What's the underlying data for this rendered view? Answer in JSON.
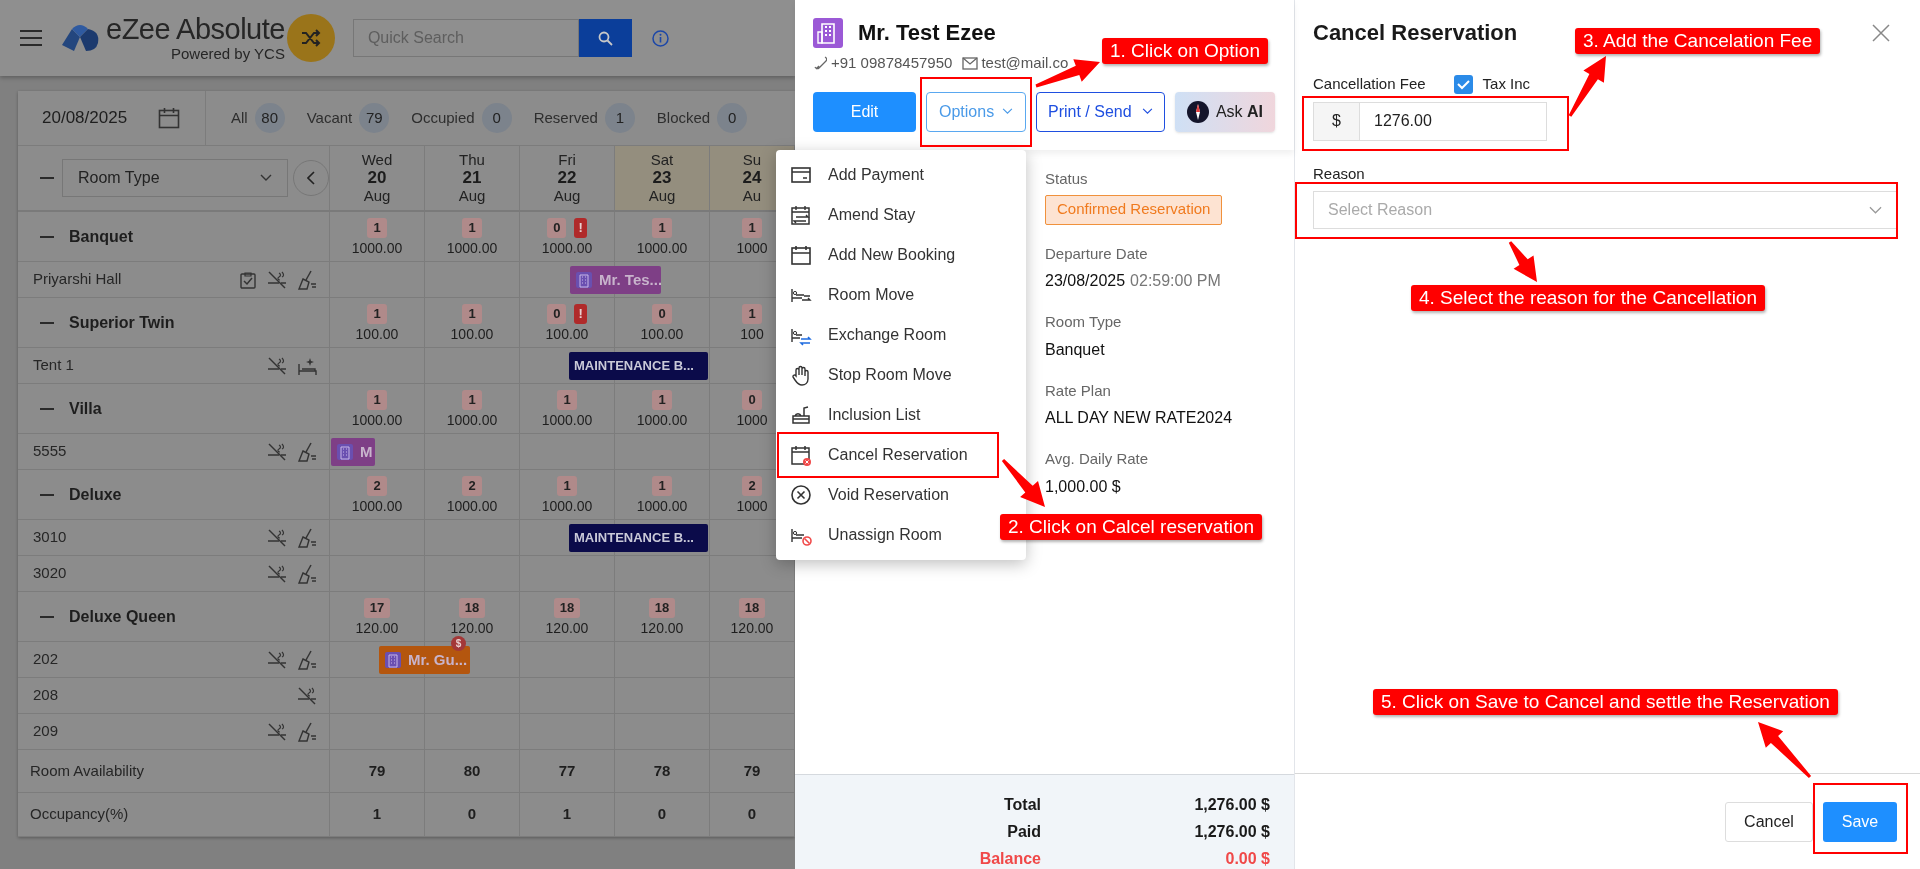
{
  "app": {
    "logo_title": "eZee Absolute",
    "logo_subtitle": "Powered by YCS",
    "search": {
      "placeholder": "Quick Search"
    }
  },
  "calendar": {
    "date": "20/08/2025",
    "filters": [
      {
        "label": "All",
        "count": "80"
      },
      {
        "label": "Vacant",
        "count": "79"
      },
      {
        "label": "Occupied",
        "count": "0"
      },
      {
        "label": "Reserved",
        "count": "1"
      },
      {
        "label": "Blocked",
        "count": "0"
      }
    ],
    "room_type_select": "Room Type",
    "days": [
      {
        "weekday": "Wed",
        "date": "20",
        "month": "Aug",
        "weekend": false
      },
      {
        "weekday": "Thu",
        "date": "21",
        "month": "Aug",
        "weekend": false
      },
      {
        "weekday": "Fri",
        "date": "22",
        "month": "Aug",
        "weekend": false
      },
      {
        "weekday": "Sat",
        "date": "23",
        "month": "Aug",
        "weekend": true
      },
      {
        "weekday": "Su",
        "date": "24",
        "month": "Au",
        "weekend": true
      }
    ],
    "groups": [
      {
        "name": "Banquet",
        "cells": [
          {
            "available": "1",
            "rate": "1000.00"
          },
          {
            "available": "1",
            "rate": "1000.00"
          },
          {
            "available": "0",
            "alert": "!",
            "rate": "1000.00"
          },
          {
            "available": "1",
            "rate": "1000.00"
          },
          {
            "available": "1",
            "rate": "1000"
          }
        ],
        "rooms": [
          {
            "name": "Priyarshi Hall",
            "bookings": [
              {
                "label": "Mr. Tes...",
                "kind": "reservation"
              }
            ]
          }
        ]
      },
      {
        "name": "Superior Twin",
        "cells": [
          {
            "available": "1",
            "rate": "100.00"
          },
          {
            "available": "1",
            "rate": "100.00"
          },
          {
            "available": "0",
            "alert": "!",
            "rate": "100.00"
          },
          {
            "available": "0",
            "rate": "100.00"
          },
          {
            "available": "1",
            "rate": "100"
          }
        ],
        "rooms": [
          {
            "name": "Tent 1",
            "bookings": [
              {
                "label": "MAINTENANCE B...",
                "kind": "maintenance"
              }
            ]
          }
        ]
      },
      {
        "name": "Villa",
        "cells": [
          {
            "available": "1",
            "rate": "1000.00"
          },
          {
            "available": "1",
            "rate": "1000.00"
          },
          {
            "available": "1",
            "rate": "1000.00"
          },
          {
            "available": "1",
            "rate": "1000.00"
          },
          {
            "available": "0",
            "rate": "1000"
          }
        ],
        "rooms": [
          {
            "name": "5555",
            "bookings": [
              {
                "label": "M",
                "kind": "reservation"
              }
            ]
          }
        ]
      },
      {
        "name": "Deluxe",
        "cells": [
          {
            "available": "2",
            "rate": "1000.00"
          },
          {
            "available": "2",
            "rate": "1000.00"
          },
          {
            "available": "1",
            "rate": "1000.00"
          },
          {
            "available": "1",
            "rate": "1000.00"
          },
          {
            "available": "2",
            "rate": "1000"
          }
        ],
        "rooms": [
          {
            "name": "3010",
            "bookings": [
              {
                "label": "MAINTENANCE B...",
                "kind": "maintenance"
              }
            ]
          },
          {
            "name": "3020"
          }
        ]
      },
      {
        "name": "Deluxe Queen",
        "cells": [
          {
            "available": "17",
            "rate": "120.00"
          },
          {
            "available": "18",
            "rate": "120.00"
          },
          {
            "available": "18",
            "rate": "120.00"
          },
          {
            "available": "18",
            "rate": "120.00"
          },
          {
            "available": "18",
            "rate": "120.00"
          }
        ],
        "rooms": [
          {
            "name": "202",
            "bookings": [
              {
                "label": "Mr. Gu...",
                "kind": "guest",
                "badge": "$"
              }
            ]
          },
          {
            "name": "208"
          },
          {
            "name": "209"
          }
        ]
      }
    ],
    "availability": {
      "label": "Room Availability",
      "values": [
        "79",
        "80",
        "77",
        "78",
        "79"
      ]
    },
    "occupancy": {
      "label": "Occupancy(%)",
      "values": [
        "1",
        "0",
        "1",
        "0",
        "0"
      ]
    }
  },
  "reservation": {
    "guest_name": "Mr. Test Ezee",
    "phone": "+91 09878457950",
    "email": "test@mail.co",
    "buttons": [
      {
        "label": "Edit",
        "kind": "primary"
      },
      {
        "label": "Options",
        "kind": "outline-light"
      },
      {
        "label": "Print / Send",
        "kind": "outline"
      },
      {
        "label": "Ask **AI**",
        "kind": "ai"
      }
    ],
    "status_label": "Status",
    "status": "Confirmed Reservation",
    "details": [
      {
        "label": "Departure Date",
        "value": "23/08/2025",
        "time": "02:59:00 PM"
      },
      {
        "label": "Room Type",
        "value": "Banquet"
      },
      {
        "label": "Rate Plan",
        "value": "ALL DAY NEW RATE2024"
      },
      {
        "label": "Avg. Daily Rate",
        "value": "1,000.00 $"
      }
    ],
    "totals": [
      {
        "label": "Total",
        "value": "1,276.00 $",
        "kind": "normal"
      },
      {
        "label": "Paid",
        "value": "1,276.00 $",
        "kind": "normal"
      },
      {
        "label": "Balance",
        "value": "0.00 $",
        "kind": "due"
      }
    ]
  },
  "options_menu": [
    {
      "label": "Add Payment"
    },
    {
      "label": "Amend Stay"
    },
    {
      "label": "Add New Booking"
    },
    {
      "label": "Room Move"
    },
    {
      "label": "Exchange Room"
    },
    {
      "label": "Stop Room Move"
    },
    {
      "label": "Inclusion List"
    },
    {
      "label": "Cancel Reservation"
    },
    {
      "label": "Void Reservation"
    },
    {
      "label": "Unassign Room"
    }
  ],
  "cancel_panel": {
    "title": "Cancel Reservation",
    "fee_label": "Cancellation Fee",
    "tax_inc": {
      "label": "Tax Inc",
      "checked": true
    },
    "currency": "$",
    "fee": "1276.00",
    "reason_label": "Reason",
    "reason_placeholder": "Select Reason",
    "buttons": [
      {
        "label": "Cancel",
        "kind": "secondary"
      },
      {
        "label": "Save",
        "kind": "primary"
      }
    ]
  },
  "annotations": [
    {
      "text": "1. Click on Option"
    },
    {
      "text": "2. Click on Calcel reservation"
    },
    {
      "text": "3. Add the Cancelation Fee"
    },
    {
      "text": "4. Select the reason for the Cancellation"
    },
    {
      "text": "5. Click on Save to Cancel and settle the Reservation"
    }
  ]
}
